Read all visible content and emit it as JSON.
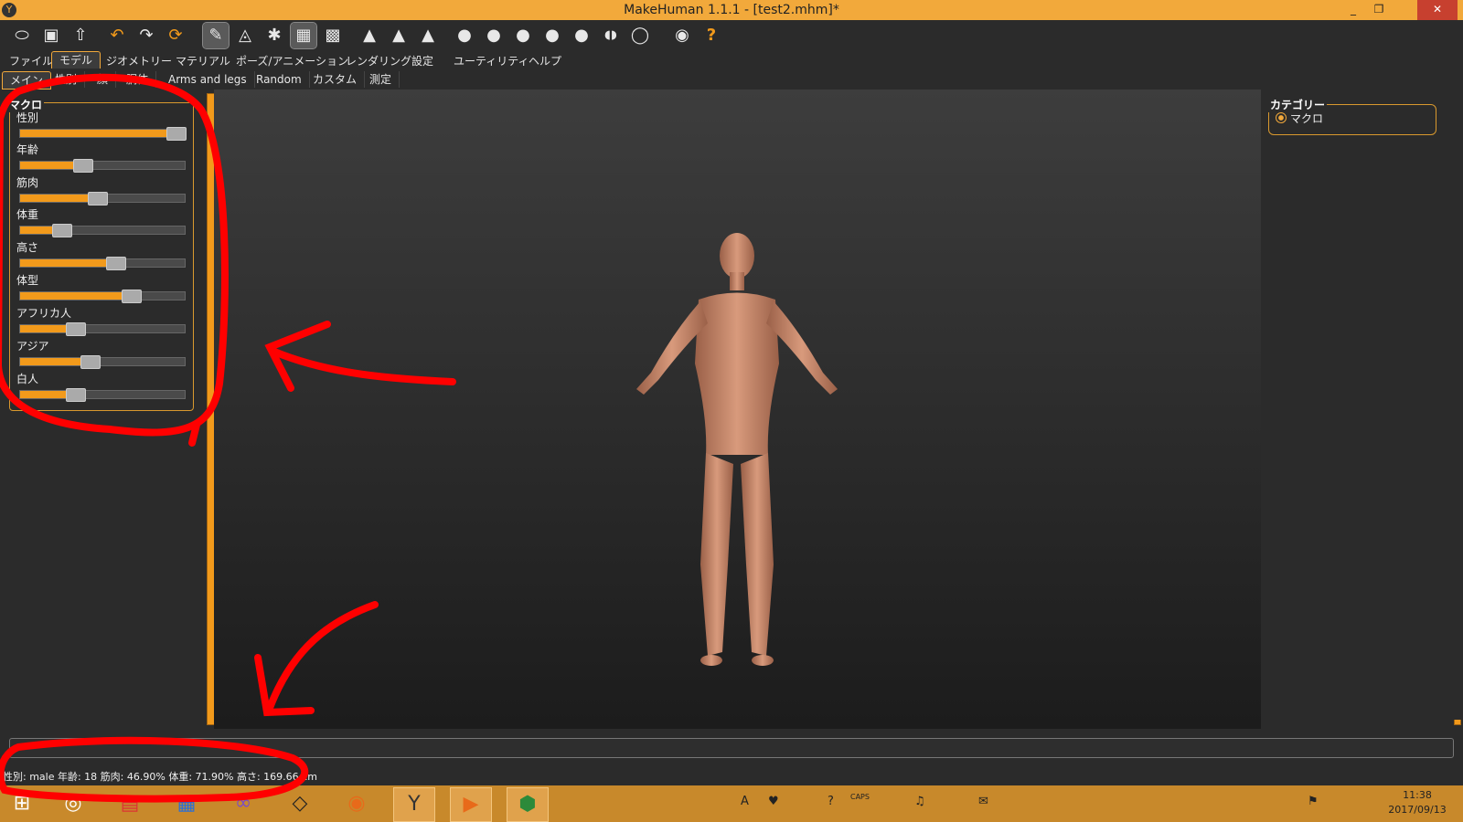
{
  "window": {
    "title": "MakeHuman 1.1.1 - [test2.mhm]*",
    "app_icon": "makehuman-logo-icon",
    "minimize": "_",
    "maximize": "❐",
    "close": "✕"
  },
  "toolbar": [
    {
      "name": "load-icon",
      "glyph": "⬭"
    },
    {
      "name": "save-icon",
      "glyph": "▣"
    },
    {
      "name": "export-icon",
      "glyph": "⇧"
    },
    {
      "name": "undo-icon",
      "glyph": "↶"
    },
    {
      "name": "redo-icon",
      "glyph": "↷"
    },
    {
      "name": "reset-icon",
      "glyph": "⟳"
    },
    {
      "name": "smooth-icon",
      "glyph": "✎"
    },
    {
      "name": "wireframe-icon",
      "glyph": "◬"
    },
    {
      "name": "pose-icon",
      "glyph": "✱"
    },
    {
      "name": "grid-icon",
      "glyph": "▦"
    },
    {
      "name": "checker-icon",
      "glyph": "▩"
    },
    {
      "name": "symmetry-right-icon",
      "glyph": "▲"
    },
    {
      "name": "symmetry-left-icon",
      "glyph": "▲"
    },
    {
      "name": "symmetry-icon",
      "glyph": "▲"
    },
    {
      "name": "front-view-icon",
      "glyph": "●"
    },
    {
      "name": "back-view-icon",
      "glyph": "●"
    },
    {
      "name": "left-view-icon",
      "glyph": "●"
    },
    {
      "name": "right-view-icon",
      "glyph": "●"
    },
    {
      "name": "top-view-icon",
      "glyph": "●"
    },
    {
      "name": "bottom-view-icon",
      "glyph": "◖◗"
    },
    {
      "name": "reset-camera-icon",
      "glyph": "◯"
    },
    {
      "name": "screenshot-icon",
      "glyph": "◉"
    },
    {
      "name": "help-icon",
      "glyph": "?"
    }
  ],
  "menu": [
    "ファイル",
    "モデル",
    "ジオメトリー",
    "マテリアル",
    "ポーズ/アニメーション",
    "レンダリング",
    "設定",
    "ユーティリティ",
    "ヘルプ"
  ],
  "subtabs": [
    "メイン",
    "性別",
    "顔",
    "胴体",
    "Arms and legs",
    "Random",
    "カスタム",
    "測定"
  ],
  "macro": {
    "title": "マクロ",
    "sliders": [
      {
        "label": "性別",
        "value": 0.95
      },
      {
        "label": "年齢",
        "value": 0.375
      },
      {
        "label": "筋肉",
        "value": 0.469
      },
      {
        "label": "体重",
        "value": 0.25
      },
      {
        "label": "高さ",
        "value": 0.58
      },
      {
        "label": "体型",
        "value": 0.67
      },
      {
        "label": "アフリカ人",
        "value": 0.333
      },
      {
        "label": "アジア",
        "value": 0.42
      },
      {
        "label": "白人",
        "value": 0.333
      }
    ]
  },
  "category": {
    "title": "カテゴリー",
    "option": "マクロ"
  },
  "status": "性別: male 年齢: 18 筋肉: 46.90% 体重: 71.90% 高さ: 169.66 cm",
  "taskbar": {
    "apps": [
      {
        "name": "start-icon",
        "glyph": "⊞"
      },
      {
        "name": "browser-icon",
        "glyph": "◎"
      },
      {
        "name": "app-red-icon",
        "glyph": "▤"
      },
      {
        "name": "store-icon",
        "glyph": "▦"
      },
      {
        "name": "visual-studio-icon",
        "glyph": "∞"
      },
      {
        "name": "unity-icon",
        "glyph": "◇"
      },
      {
        "name": "blender-icon",
        "glyph": "◉"
      },
      {
        "name": "makehuman-icon",
        "glyph": "Y"
      },
      {
        "name": "media-player-icon",
        "glyph": "▶"
      },
      {
        "name": "app-green-icon",
        "glyph": "⬢"
      }
    ],
    "tray": [
      "A",
      "♥",
      "?",
      "CAPS",
      "♫",
      "✉",
      "⚑"
    ],
    "time": "11:38",
    "date": "2017/09/13"
  }
}
